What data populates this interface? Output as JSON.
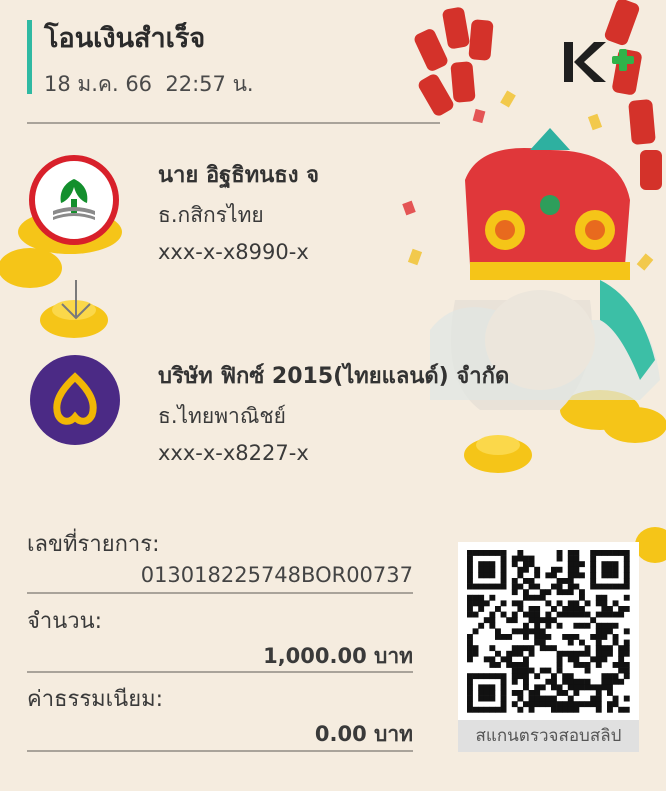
{
  "header": {
    "title": "โอนเงินสำเร็จ",
    "datetime": "18 ม.ค. 66  22:57 น.",
    "logo_icon": "k-plus-logo-icon"
  },
  "sender": {
    "name": "นาย อิฐธิทนธง จ",
    "bank": "ธ.กสิกรไทย",
    "account": "xxx-x-x8990-x",
    "bank_logo_icon": "kasikorn-bank-logo-icon"
  },
  "transfer_arrow_icon": "arrow-down-icon",
  "receiver": {
    "name": "บริษัท ฟิกซ์ 2015(ไทยแลนด์) จำกัด",
    "bank": "ธ.ไทยพาณิชย์",
    "account": "xxx-x-x8227-x",
    "bank_logo_icon": "scb-bank-logo-icon"
  },
  "details": {
    "ref_label": "เลขที่รายการ:",
    "ref_value": "013018225748BOR00737",
    "amount_label": "จำนวน:",
    "amount_value": "1,000.00 บาท",
    "fee_label": "ค่าธรรมเนียม:",
    "fee_value": "0.00 บาท"
  },
  "qr": {
    "caption": "สแกนตรวจสอบสลิป",
    "icon": "qr-code-icon"
  },
  "colors": {
    "accent": "#2fb9a2",
    "background": "#f5ecdf",
    "kbank_green": "#138f2d",
    "kbank_red": "#d8202a",
    "scb_purple": "#4b2a85",
    "scb_gold": "#f2b705"
  }
}
